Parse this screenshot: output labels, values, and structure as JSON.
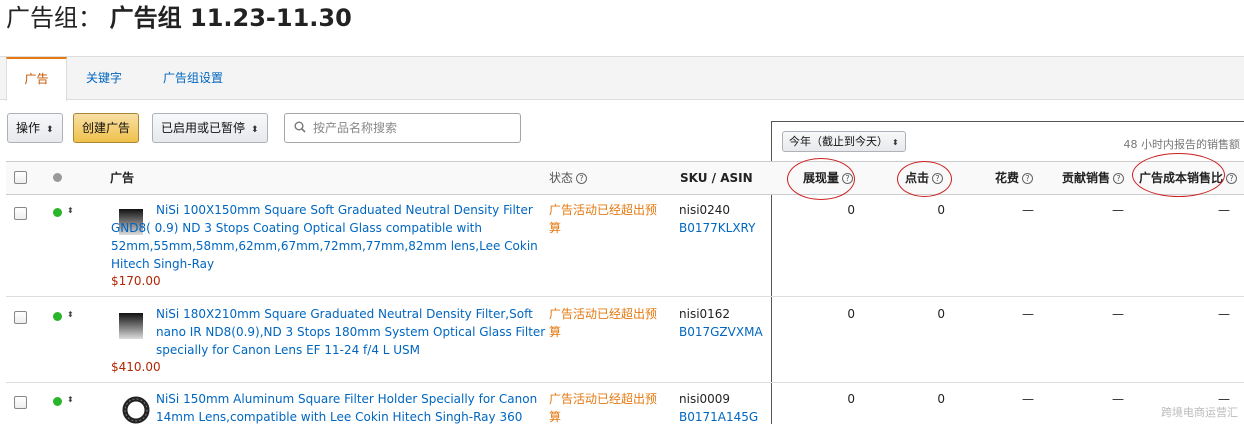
{
  "page": {
    "title_prefix": "广告组：",
    "title_name": "广告组 11.23-11.30"
  },
  "tabs": [
    {
      "label": "广告",
      "active": true
    },
    {
      "label": "关键字",
      "active": false
    },
    {
      "label": "广告组设置",
      "active": false
    }
  ],
  "toolbar": {
    "actions_label": "操作",
    "create_label": "创建广告",
    "filter_label": "已启用或已暂停",
    "search_placeholder": "按产品名称搜索"
  },
  "metrics": {
    "date_range": "今年（截止到今天）",
    "report_note": "48 小时内报告的销售额"
  },
  "columns": {
    "ad": "广告",
    "status": "状态",
    "sku_asin": "SKU / ASIN",
    "impressions": "展现量",
    "clicks": "点击",
    "spend": "花费",
    "sales": "贡献销售",
    "acos": "广告成本销售比"
  },
  "rows": [
    {
      "name": "NiSi 100X150mm Square Soft Graduated Neutral Density Filter GND8( 0.9) ND 3 Stops Coating Optical Glass compatible with 52mm,55mm,58mm,62mm,67mm,72mm,77mm,82mm lens,Lee Cokin Hitech Singh-Ray",
      "price": "$170.00",
      "status": "广告活动已经超出预算",
      "sku": "nisi0240",
      "asin": "B0177KLXRY",
      "impressions": "0",
      "clicks": "0",
      "spend": "—",
      "sales": "—",
      "acos": "—"
    },
    {
      "name": "NiSi 180X210mm Square Graduated Neutral Density Filter,Soft nano IR ND8(0.9),ND 3 Stops 180mm System Optical Glass Filter specially for Canon Lens EF 11-24 f/4 L USM",
      "price": "$410.00",
      "status": "广告活动已经超出预算",
      "sku": "nisi0162",
      "asin": "B017GZVXMA",
      "impressions": "0",
      "clicks": "0",
      "spend": "—",
      "sales": "—",
      "acos": "—"
    },
    {
      "name": "NiSi 150mm Aluminum Square Filter Holder Specially for Canon 14mm Lens,compatible with Lee Cokin Hitech Singh-Ray 360",
      "price": "",
      "status": "广告活动已经超出预算",
      "sku": "nisi0009",
      "asin": "B0171A145G",
      "impressions": "0",
      "clicks": "0",
      "spend": "—",
      "sales": "—",
      "acos": "—"
    }
  ],
  "icons": {
    "status_active": "green-dot-icon",
    "search": "search-icon",
    "help": "question-circle-icon"
  },
  "colors": {
    "link": "#0066c0",
    "status_warning": "#e47911",
    "price": "#b12704",
    "active_dot": "#2bb52b",
    "annotation": "#cc2020"
  },
  "watermark": "跨境电商运营汇"
}
